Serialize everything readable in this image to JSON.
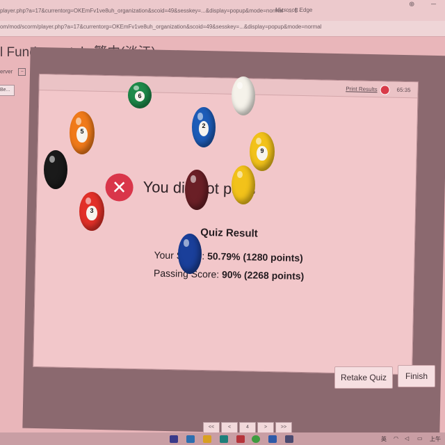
{
  "browser": {
    "title_text": "player.php?a=17&currentorg=OKEmFv1ve8uh_organization&scoid=49&sesskey=...&display=popup&mode=normal - ... 1 - ",
    "app_name": "Microsoft Edge",
    "url": "om/mod/scorm/player.php?a=17&currentorg=OKEmFv1ve8uh_organization&scoid=49&sesskey=...&display=popup&mode=normal"
  },
  "page": {
    "heading": "l Fundamentals 繁中(淡江)",
    "left_label": "erver",
    "left_btn": "Be..."
  },
  "quiz": {
    "print_results": "Print Results",
    "timer": "65:35",
    "status_text": "You did not pass",
    "result_title": "Quiz Result",
    "score_label": "Your Score:",
    "score_value": "50.79% (1280 points)",
    "passing_label": "Passing Score:",
    "passing_value": "90% (2268 points)",
    "retake_label": "Retake Quiz",
    "finish_label": "Finish"
  },
  "pager": [
    "<<",
    "<",
    "4",
    ">",
    ">>"
  ],
  "taskbar": {
    "tray_time": "上午",
    "tray_ime": "英"
  },
  "colors": {
    "fail_red": "#d9364a",
    "panel_bg": "#f2c7ca"
  },
  "balls": [
    {
      "name": "ball-6-green",
      "color": "#1e8a4a",
      "number": "6"
    },
    {
      "name": "ball-white",
      "color": "#f5f2ea",
      "number": ""
    },
    {
      "name": "ball-5-orange",
      "color": "#f07a1a",
      "number": "5"
    },
    {
      "name": "ball-2-blue",
      "color": "#1d5cb8",
      "number": "2"
    },
    {
      "name": "ball-9-yellow-stripe",
      "color": "#f2c21a",
      "number": "9"
    },
    {
      "name": "ball-8-black",
      "color": "#1a1a1a",
      "number": ""
    },
    {
      "name": "ball-7-maroon",
      "color": "#6a1f26",
      "number": ""
    },
    {
      "name": "ball-1-yellow",
      "color": "#f2c21a",
      "number": ""
    },
    {
      "name": "ball-3-red",
      "color": "#e23028",
      "number": "3"
    },
    {
      "name": "ball-10-blue",
      "color": "#1a3f9a",
      "number": ""
    }
  ]
}
